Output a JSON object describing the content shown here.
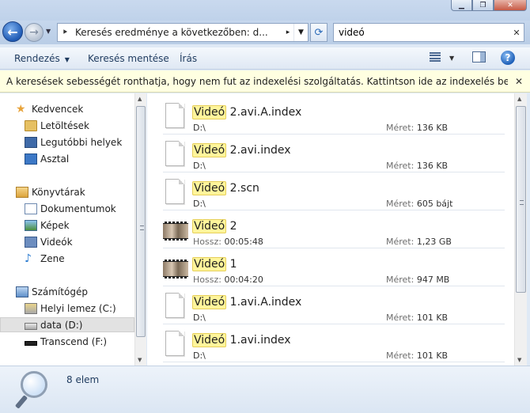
{
  "window": {
    "buttons": {
      "minimize": "▁",
      "maximize": "❐",
      "close": "✕"
    }
  },
  "nav": {
    "address": "Keresés eredménye a következőben: d...",
    "search_value": "videó"
  },
  "toolbar": {
    "organize": "Rendezés",
    "save_search": "Keresés mentése",
    "burn": "Írás"
  },
  "infobar": {
    "text": "A keresések sebességét ronthatja, hogy nem fut az indexelési szolgáltatás. Kattintson ide az indexelés bekapcsolásáho..."
  },
  "sidebar": {
    "favorites": {
      "label": "Kedvencek",
      "items": [
        "Letöltések",
        "Legutóbbi helyek",
        "Asztal"
      ]
    },
    "libraries": {
      "label": "Könyvtárak",
      "items": [
        "Dokumentumok",
        "Képek",
        "Videók",
        "Zene"
      ]
    },
    "computer": {
      "label": "Számítógép",
      "items": [
        "Helyi lemez (C:)",
        "data (D:)",
        "Transcend (F:)"
      ]
    }
  },
  "files": [
    {
      "highlight": "Videó",
      "rest": " 2.avi.A.index",
      "sub_label": "",
      "sub_value": "D:\\",
      "size_label": "Méret:",
      "size": "136 KB",
      "type": "file"
    },
    {
      "highlight": "Videó",
      "rest": " 2.avi.index",
      "sub_label": "",
      "sub_value": "D:\\",
      "size_label": "Méret:",
      "size": "136 KB",
      "type": "file"
    },
    {
      "highlight": "Videó",
      "rest": " 2.scn",
      "sub_label": "",
      "sub_value": "D:\\",
      "size_label": "Méret:",
      "size": "605 bájt",
      "type": "file"
    },
    {
      "highlight": "Videó",
      "rest": " 2",
      "sub_label": "Hossz:",
      "sub_value": "00:05:48",
      "size_label": "Méret:",
      "size": "1,23 GB",
      "type": "video"
    },
    {
      "highlight": "Videó",
      "rest": " 1",
      "sub_label": "Hossz:",
      "sub_value": "00:04:20",
      "size_label": "Méret:",
      "size": "947 MB",
      "type": "video"
    },
    {
      "highlight": "Videó",
      "rest": " 1.avi.A.index",
      "sub_label": "",
      "sub_value": "D:\\",
      "size_label": "Méret:",
      "size": "101 KB",
      "type": "file"
    },
    {
      "highlight": "Videó",
      "rest": " 1.avi.index",
      "sub_label": "",
      "sub_value": "D:\\",
      "size_label": "Méret:",
      "size": "101 KB",
      "type": "file"
    }
  ],
  "details": {
    "count": "8 elem"
  },
  "colors": {
    "highlight": "#fff59b",
    "infobar": "#ffffe1",
    "chrome": "#c6d7ed"
  }
}
